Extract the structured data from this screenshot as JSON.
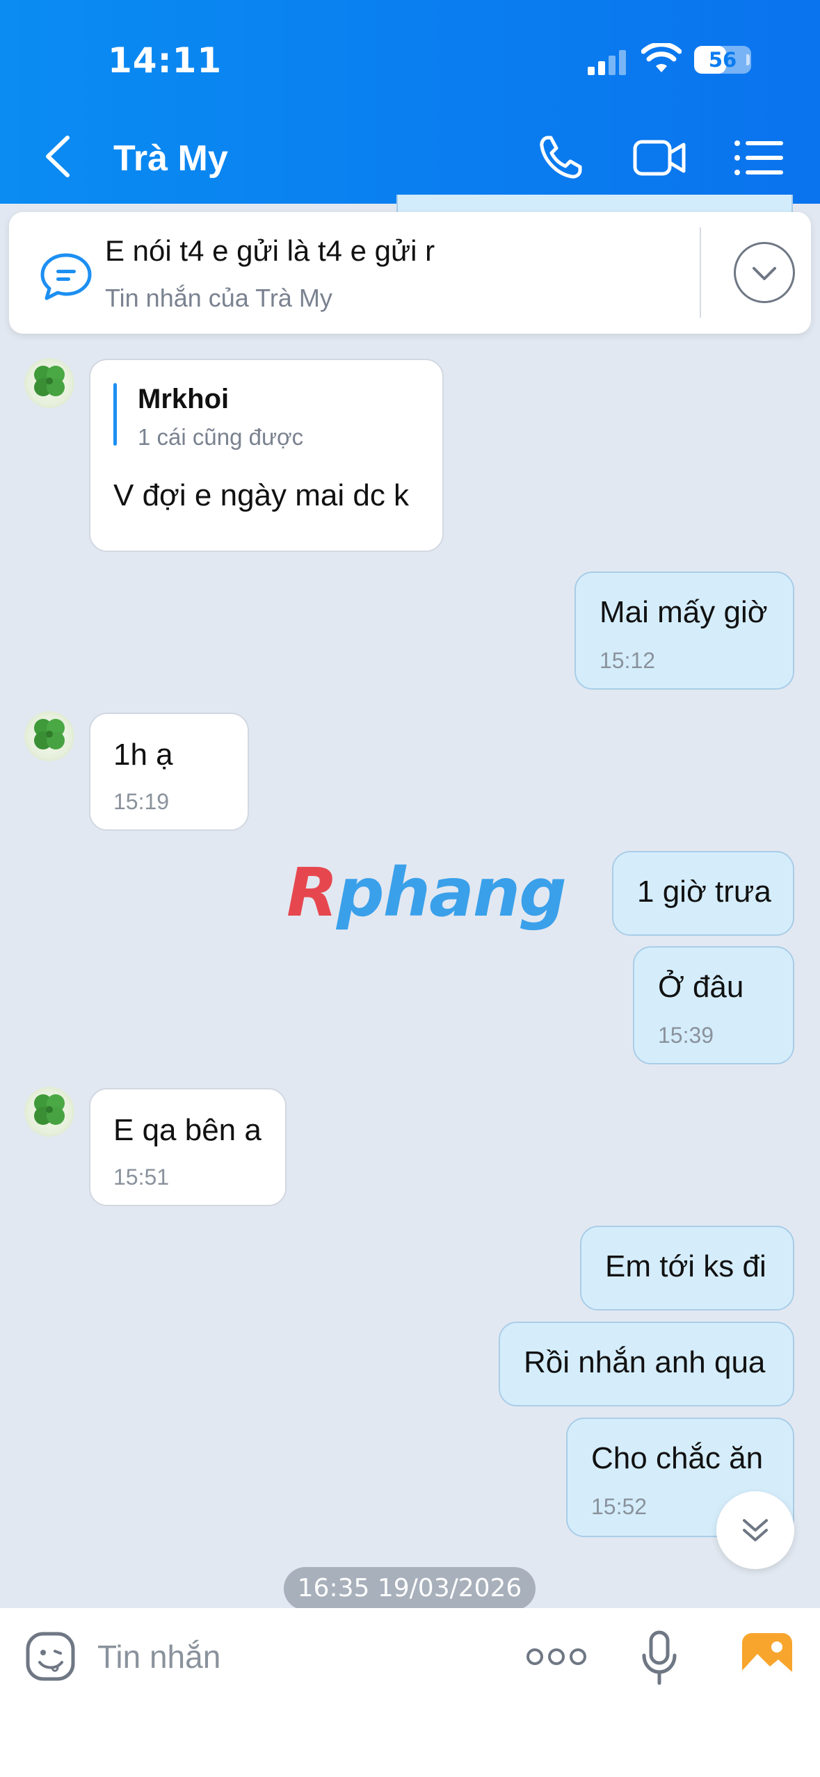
{
  "status_bar": {
    "time": "14:11",
    "battery": "56",
    "battery_level": 0.56
  },
  "header": {
    "title": "Trà My",
    "icons": [
      "back-icon",
      "phone-icon",
      "video-call-icon",
      "list-menu-icon"
    ]
  },
  "pinned": {
    "text": "E nói t4 e gửi là t4 e gửi r",
    "subtitle": "Tin nhắn của Trà My",
    "icon": "message-icon"
  },
  "messages": [
    {
      "side": "in",
      "quote_author": "Mrkhoi",
      "quote_text": "1 cái cũng được",
      "text": "V đợi e ngày mai dc k",
      "time": ""
    },
    {
      "side": "out",
      "text": "Mai mấy giờ",
      "time": "15:12"
    },
    {
      "side": "in",
      "text": "1h ạ",
      "time": "15:19"
    },
    {
      "side": "out",
      "text": "1 giờ trưa",
      "time": ""
    },
    {
      "side": "out",
      "text": "Ở đâu",
      "time": "15:39"
    },
    {
      "side": "in",
      "text": "E qa bên a",
      "time": "15:51"
    },
    {
      "side": "out",
      "text": "Em tới ks đi",
      "time": ""
    },
    {
      "side": "out",
      "text": "Rồi nhắn anh qua",
      "time": ""
    },
    {
      "side": "out",
      "text": "Cho chắc ăn",
      "time": "15:52"
    }
  ],
  "watermark": {
    "first": "R",
    "rest": "phang"
  },
  "date_divider": "16:35 19/03/2026",
  "input_bar": {
    "placeholder": "Tin nhắn",
    "icons": [
      "emoji-icon",
      "more-icon",
      "microphone-icon",
      "photo-icon"
    ]
  },
  "colors": {
    "header": "#0a7cf0",
    "background": "#e2e8f1",
    "incoming_bubble": "#ffffff",
    "outgoing_bubble": "#d5edfb",
    "accent": "#1c8ff2",
    "photo_icon": "#f7a52c"
  }
}
